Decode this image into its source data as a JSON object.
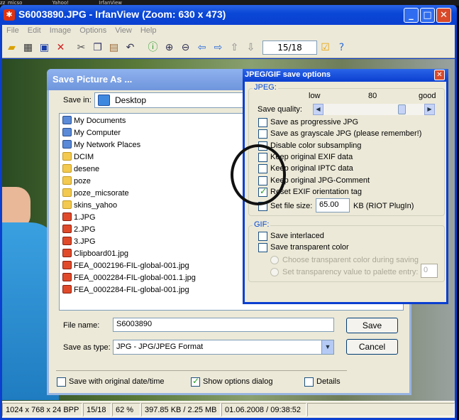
{
  "desktop": {
    "items": [
      "zz_micso",
      "Yahoo!",
      "IrfanView"
    ]
  },
  "window": {
    "title": "S6003890.JPG - IrfanView (Zoom: 630 x 473)",
    "min": "_",
    "max": "□",
    "close": "✕"
  },
  "menu": [
    "File",
    "Edit",
    "Image",
    "Options",
    "View",
    "Help"
  ],
  "toolbar": {
    "page": "15/18"
  },
  "status": {
    "dims": "1024 x 768 x 24 BPP",
    "index": "15/18",
    "zoom": "62 %",
    "size": "397.85 KB / 2.25 MB",
    "datetime": "01.06.2008 / 09:38:52"
  },
  "save_dialog": {
    "title": "Save Picture As ...",
    "save_in_label": "Save in:",
    "save_in_value": "Desktop",
    "files": [
      {
        "name": "My Documents",
        "type": "sys"
      },
      {
        "name": "My Computer",
        "type": "sys"
      },
      {
        "name": "My Network Places",
        "type": "sys"
      },
      {
        "name": "DCIM",
        "type": "folder"
      },
      {
        "name": "desene",
        "type": "folder"
      },
      {
        "name": "poze",
        "type": "folder"
      },
      {
        "name": "poze_micsorate",
        "type": "folder"
      },
      {
        "name": "skins_yahoo",
        "type": "folder"
      },
      {
        "name": "1.JPG",
        "type": "jpg"
      },
      {
        "name": "2.JPG",
        "type": "jpg"
      },
      {
        "name": "3.JPG",
        "type": "jpg"
      },
      {
        "name": "Clipboard01.jpg",
        "type": "jpg"
      },
      {
        "name": "FEA_0002196-FIL-global-001.jpg",
        "type": "jpg"
      },
      {
        "name": "FEA_0002284-FIL-global-001.1.jpg",
        "type": "jpg"
      },
      {
        "name": "FEA_0002284-FIL-global-001.jpg",
        "type": "jpg"
      }
    ],
    "file_name_label": "File name:",
    "file_name_value": "S6003890",
    "save_type_label": "Save as type:",
    "save_type_value": "JPG - JPG/JPEG Format",
    "save_button": "Save",
    "cancel_button": "Cancel",
    "orig_date_label": "Save with original date/time",
    "show_options_label": "Show options dialog",
    "details_label": "Details"
  },
  "jpeg_options": {
    "title": "JPEG/GIF save options",
    "jpeg_group": "JPEG:",
    "low": "low",
    "quality_value": "80",
    "good": "good",
    "quality_label": "Save quality:",
    "options": [
      {
        "label": "Save as progressive JPG",
        "checked": false
      },
      {
        "label": "Save as grayscale JPG (please remember!)",
        "checked": false
      },
      {
        "label": "Disable color subsampling",
        "checked": false
      },
      {
        "label": "Keep original EXIF data",
        "checked": false
      },
      {
        "label": "Keep original IPTC data",
        "checked": false
      },
      {
        "label": "Keep original JPG-Comment",
        "checked": false
      },
      {
        "label": "Reset EXIF orientation tag",
        "checked": true
      }
    ],
    "file_size_label": "Set file size:",
    "file_size_value": "65.00",
    "file_size_unit": "KB (RIOT PlugIn)",
    "gif_group": "GIF:",
    "interlaced": "Save interlaced",
    "transparent": "Save transparent color",
    "choose_trans": "Choose transparent color during saving",
    "set_trans": "Set transparency value to palette entry:",
    "trans_value": "0"
  }
}
